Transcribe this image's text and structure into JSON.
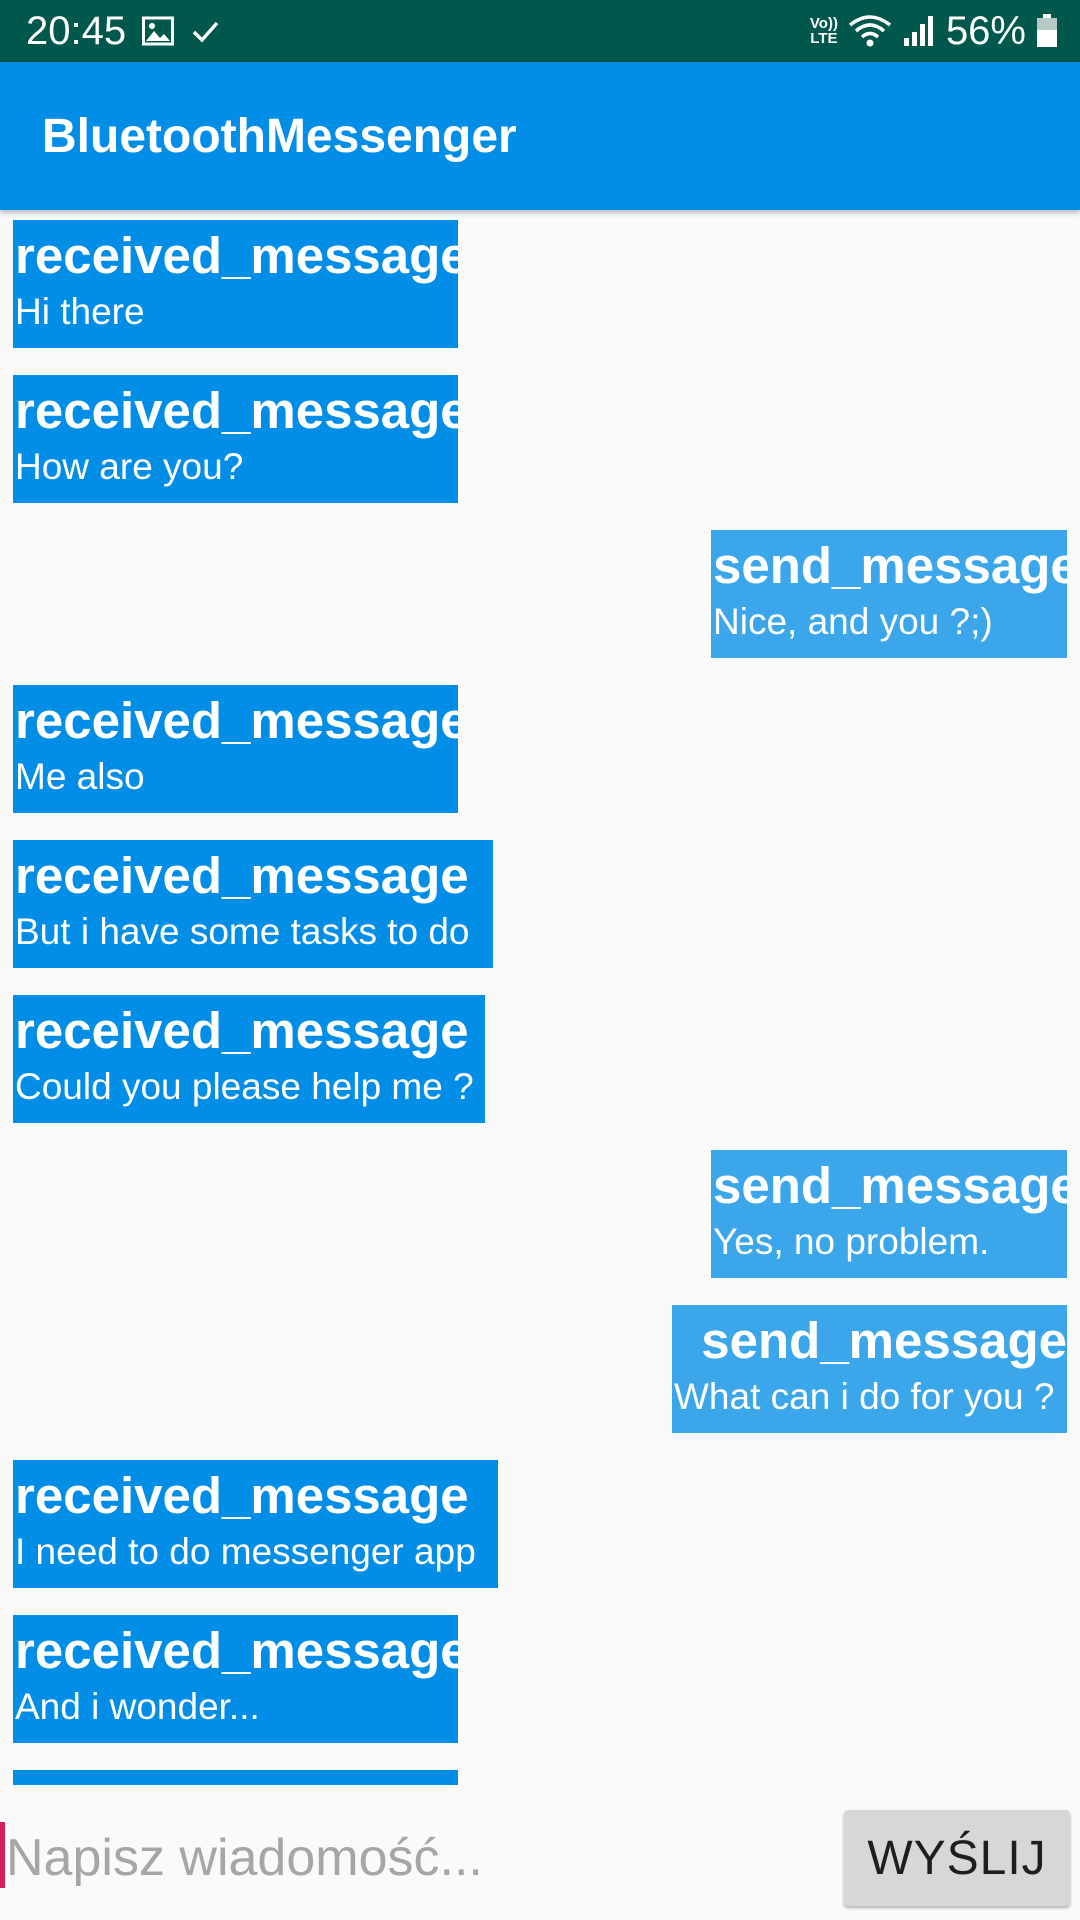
{
  "status_bar": {
    "time": "20:45",
    "notification_icons": [
      "image-icon",
      "check-icon"
    ],
    "volte_label_top": "Vo))",
    "volte_label_bottom": "LTE",
    "battery": "56%"
  },
  "app_bar": {
    "title": "BluetoothMessenger"
  },
  "messages": [
    {
      "type": "received",
      "sender": "received_message",
      "text": "Hi there"
    },
    {
      "type": "received",
      "sender": "received_message",
      "text": "How are you?"
    },
    {
      "type": "sent",
      "sender": "send_message",
      "text": "Nice, and you ?;)"
    },
    {
      "type": "received",
      "sender": "received_message",
      "text": "Me also"
    },
    {
      "type": "received",
      "sender": "received_message",
      "text": "But i have some tasks to do"
    },
    {
      "type": "received",
      "sender": "received_message",
      "text": "Could you please help me ?"
    },
    {
      "type": "sent",
      "sender": "send_message",
      "text": "Yes, no problem."
    },
    {
      "type": "sent",
      "sender": "send_message",
      "text": "What can i do for you ?"
    },
    {
      "type": "received",
      "sender": "received_message",
      "text": "I need to do messenger app"
    },
    {
      "type": "received",
      "sender": "received_message",
      "text": "And i wonder..."
    }
  ],
  "input": {
    "placeholder": "Napisz wiadomość...",
    "value": ""
  },
  "send_button": {
    "label": "WYŚLIJ"
  },
  "colors": {
    "status_bar": "#00574b",
    "app_bar": "#028ee7",
    "received_bubble": "#028ee7",
    "sent_bubble": "#3ba7ea",
    "cursor_accent": "#d81b60"
  }
}
